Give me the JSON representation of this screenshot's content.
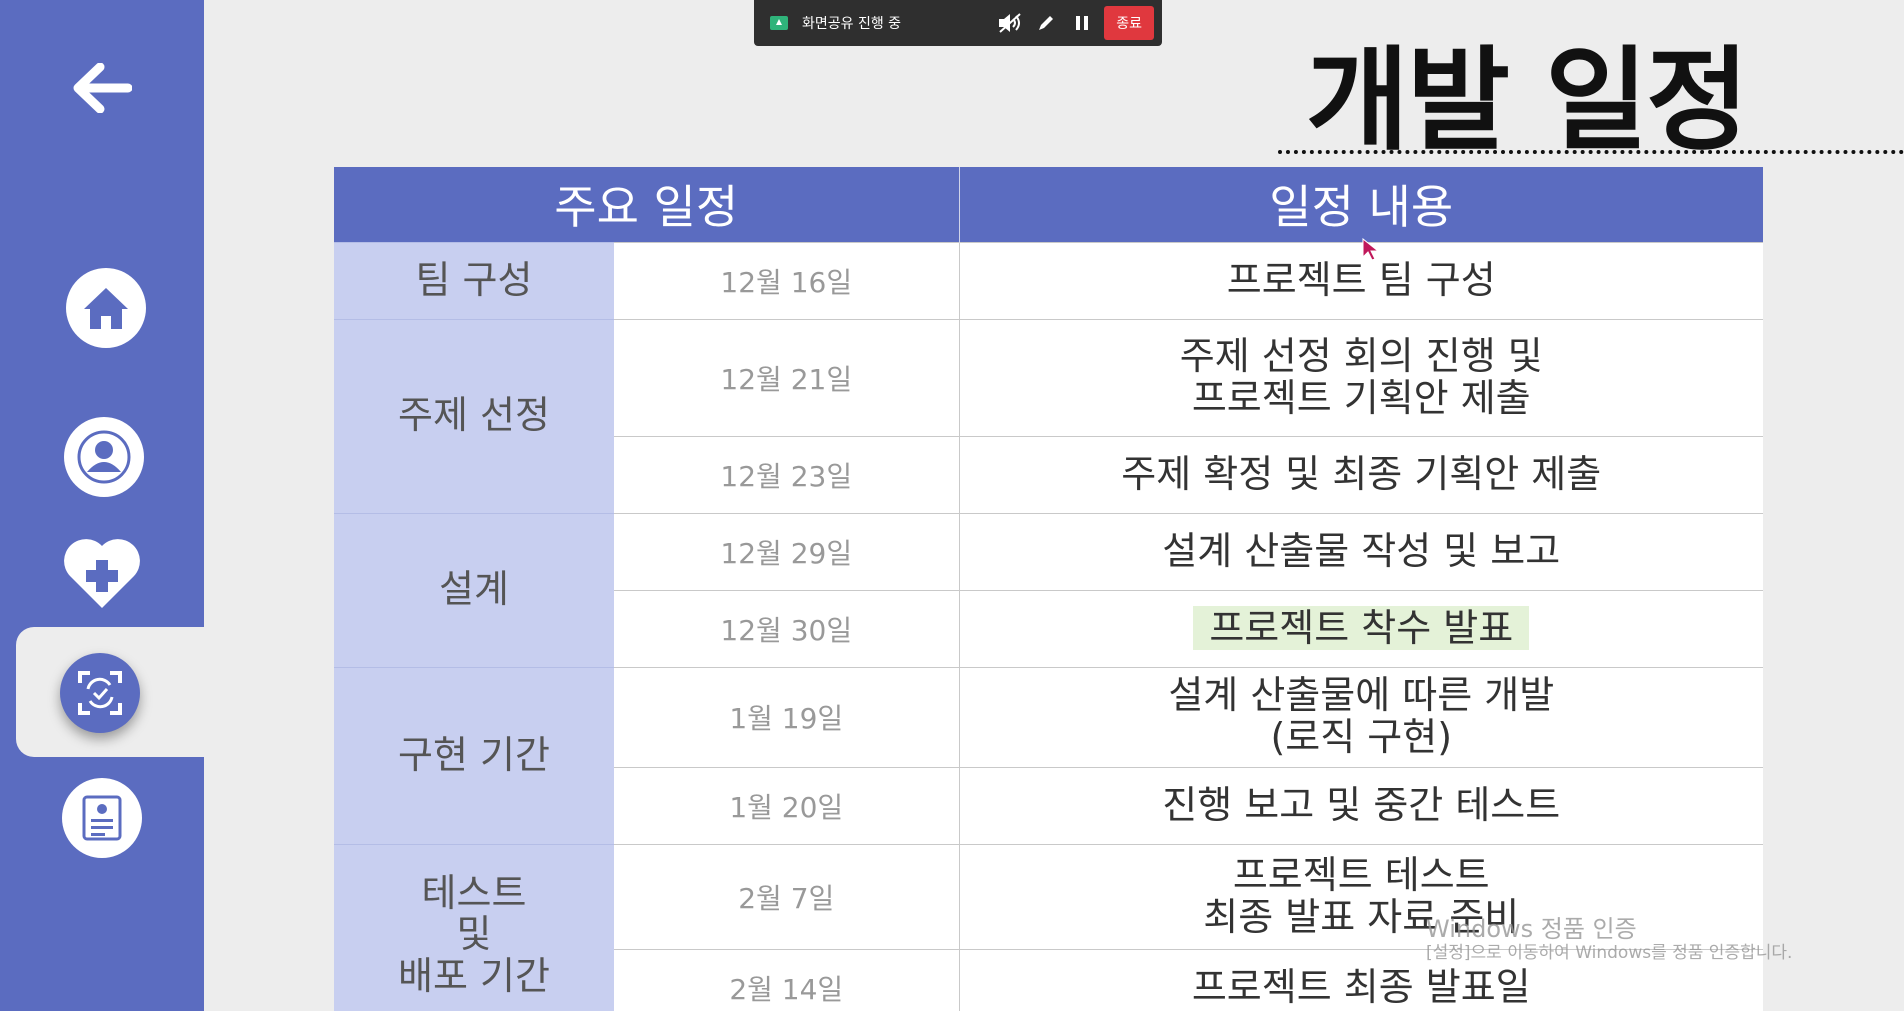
{
  "share_bar": {
    "label": "화면공유 진행 중",
    "end_label": "종료",
    "icons": [
      "screen-share-icon",
      "speaker-muted-icon",
      "pen-icon",
      "pause-icon"
    ]
  },
  "title": "개발 일정",
  "table": {
    "headers": [
      "주요 일정",
      "일정 내용"
    ],
    "phases": [
      "팀 구성",
      "주제 선정",
      "설계",
      "구현 기간",
      "테스트\n및\n배포 기간"
    ],
    "rows": [
      {
        "date": "12월 16일",
        "content": "프로젝트 팀 구성"
      },
      {
        "date": "12월 21일",
        "content": "주제 선정 회의 진행 및\n프로젝트 기획안 제출"
      },
      {
        "date": "12월 23일",
        "content": "주제 확정 및 최종 기획안 제출"
      },
      {
        "date": "12월 29일",
        "content": "설계 산출물 작성 및 보고"
      },
      {
        "date": "12월 30일",
        "content": "프로젝트 착수 발표"
      },
      {
        "date": "1월 19일",
        "content": "설계 산출물에 따른 개발\n(로직 구현)"
      },
      {
        "date": "1월 20일",
        "content": "진행 보고 및 중간 테스트"
      },
      {
        "date": "2월 7일",
        "content": "프로젝트 테스트\n최종 발표 자료 준비"
      },
      {
        "date": "2월 14일",
        "content": "프로젝트 최종 발표일"
      }
    ]
  },
  "watermark": {
    "line1": "Windows 정품 인증",
    "line2": "[설정]으로 이동하여 Windows를 정품 인증합니다."
  },
  "sidebar": {
    "items": [
      "back-arrow-icon",
      "home-icon",
      "user-icon",
      "heart-plus-icon",
      "schedule-refresh-icon",
      "document-icon"
    ]
  },
  "colors": {
    "sidebar": "#5b6cc0",
    "header": "#5b6cc0",
    "phase_cell": "#c8cff0",
    "end_button": "#e0383e",
    "highlight": "#e4f2d8"
  }
}
